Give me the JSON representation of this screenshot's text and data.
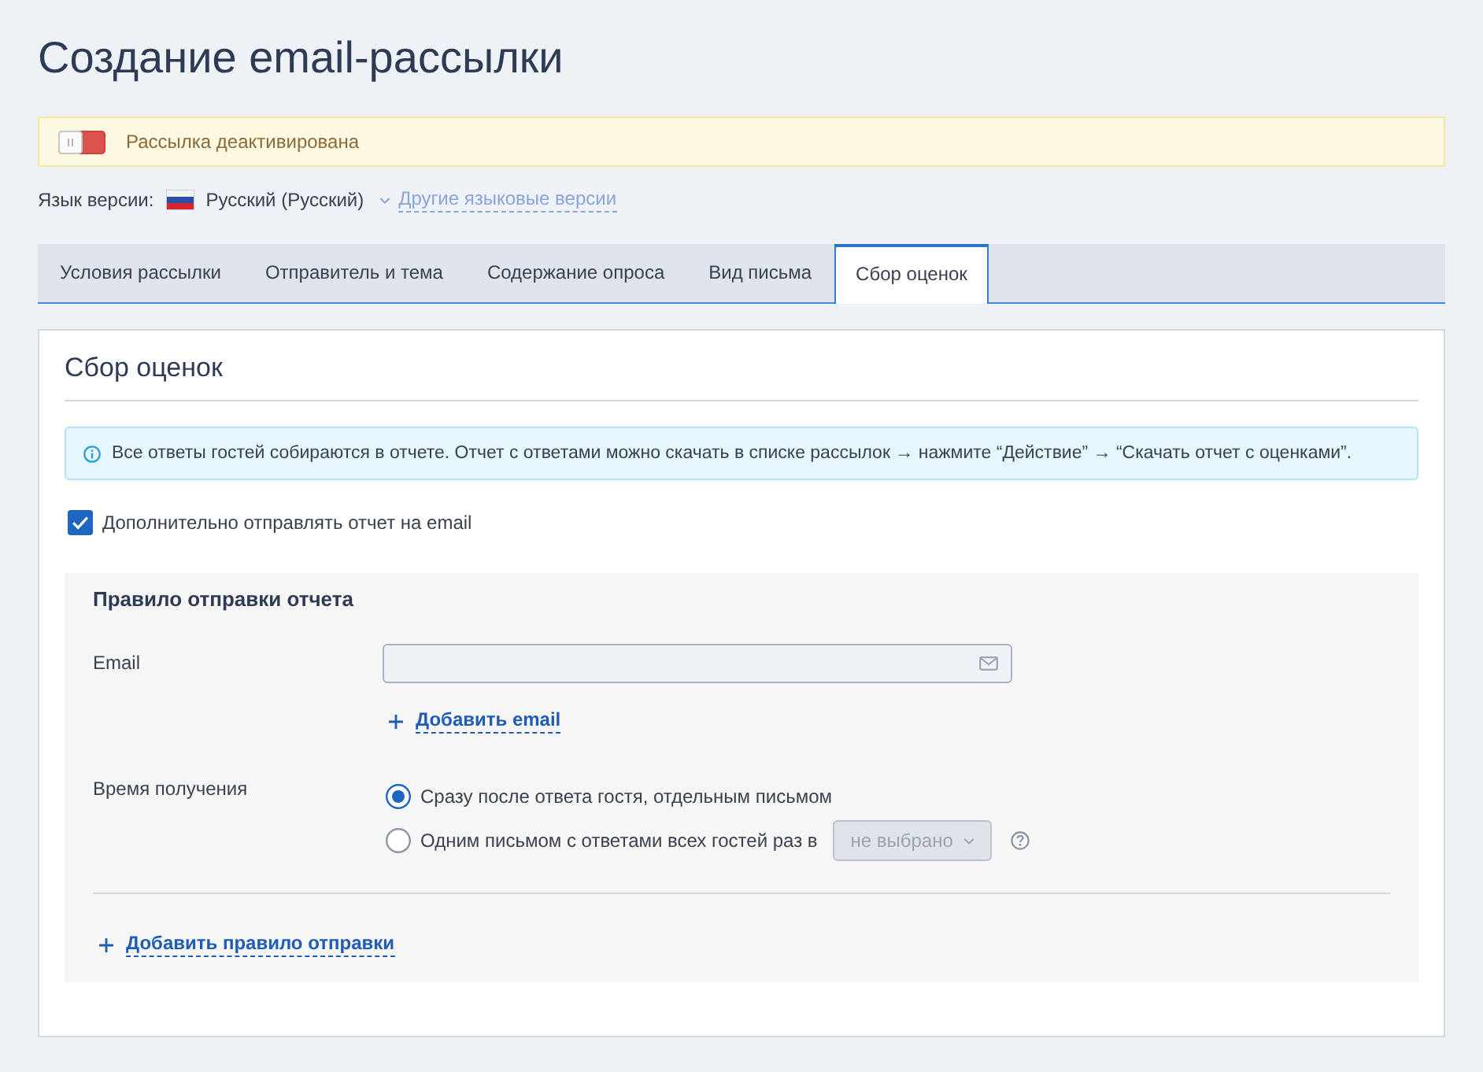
{
  "page_title": "Создание email-рассылки",
  "status_alert": {
    "toggle": {
      "on": false
    },
    "text": "Рассылка деактивирована"
  },
  "language": {
    "label": "Язык версии:",
    "current": "Русский (Русский)",
    "other_versions_link": "Другие языковые версии"
  },
  "tabs": [
    {
      "label": "Условия рассылки",
      "selected": false
    },
    {
      "label": "Отправитель и тема",
      "selected": false
    },
    {
      "label": "Содержание опроса",
      "selected": false
    },
    {
      "label": "Вид письма",
      "selected": false
    },
    {
      "label": "Сбор оценок",
      "selected": true
    }
  ],
  "panel": {
    "title": "Сбор оценок",
    "info": "Все ответы гостей собираются в отчете. Отчет с ответами можно скачать в списке рассылок → нажмите “Действие” → “Скачать отчет с оценками”.",
    "send_report": {
      "label": "Дополнительно отправлять отчет на email",
      "checked": true
    },
    "rule": {
      "title": "Правило отправки отчета",
      "email_field": {
        "label": "Email"
      },
      "add_email_link": "Добавить email",
      "receive_time": {
        "label": "Время получения",
        "options": [
          {
            "label": "Сразу после ответа гостя, отдельным письмом",
            "selected": true
          },
          {
            "label": "Одним письмом с ответами всех гостей раз в",
            "selected": false,
            "interval_select": {
              "value": "не выбрано",
              "disabled": true
            }
          }
        ]
      },
      "add_rule_link": "Добавить правило отправки"
    }
  }
}
